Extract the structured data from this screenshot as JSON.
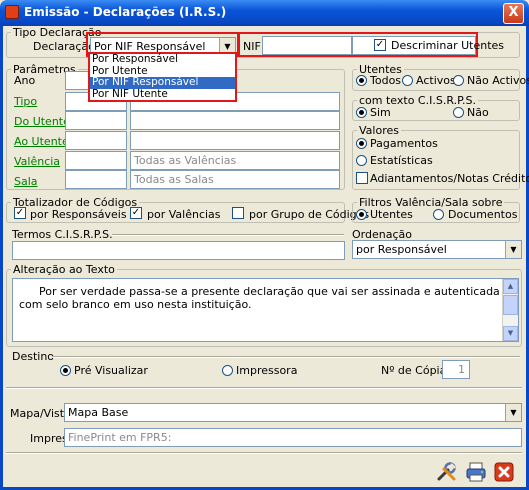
{
  "window": {
    "title": "Emissão - Declarações (I.R.S.)",
    "close": "X"
  },
  "tipo": {
    "legend": "Tipo Declaração",
    "declaracao_label": "Declaração",
    "declaracao_value": "Por NIF Responsável",
    "options": [
      "Por Responsável",
      "Por Utente",
      "Por NIF Responsável",
      "Por NIF Utente"
    ],
    "selected_index": 2,
    "nif_label": "NIF",
    "nif_value": "",
    "discriminar_label": "Descriminar Utentes",
    "discriminar_checked": true
  },
  "parametros": {
    "legend": "Parâmetros",
    "ano_label": "Ano",
    "tipo_label": "Tipo",
    "do_utente_label": "Do Utente",
    "ao_utente_label": "Ao Utente",
    "valencia_label": "Valência",
    "valencia_placeholder": "Todas as Valências",
    "sala_label": "Sala",
    "sala_placeholder": "Todas as Salas"
  },
  "utentes": {
    "legend": "Utentes",
    "options": [
      "Todos",
      "Activos",
      "Não Activos"
    ],
    "selected": 0
  },
  "texto": {
    "legend": "com texto C.I.S.R.P.S.",
    "options": [
      "Sim",
      "Não"
    ],
    "selected": 0
  },
  "valores": {
    "legend": "Valores",
    "options": [
      "Pagamentos",
      "Estatísticas"
    ],
    "selected": 0,
    "adiantamentos_label": "Adiantamentos/Notas Crédito",
    "adiantamentos_checked": false
  },
  "totalizador": {
    "legend": "Totalizador de Códigos",
    "items": [
      {
        "label": "por Responsáveis",
        "checked": true
      },
      {
        "label": "por Valências",
        "checked": true
      },
      {
        "label": "por Grupo de Códigos",
        "checked": false
      }
    ]
  },
  "filtros": {
    "legend": "Filtros Valência/Sala sobre",
    "options": [
      "Utentes",
      "Documentos"
    ],
    "selected": 0
  },
  "termos": {
    "legend": "Termos C.I.S.R.P.S.",
    "value": ""
  },
  "ordenacao": {
    "legend": "Ordenação",
    "value": "por Responsável"
  },
  "alteracao": {
    "legend": "Alteração ao Texto",
    "text": "Por ser verdade passa-se a presente declaração que vai ser assinada e autenticada com selo branco em uso nesta instituição."
  },
  "destino": {
    "legend": "Destino",
    "options": [
      "Pré Visualizar",
      "Impressora"
    ],
    "selected": 0,
    "copias_label": "Nº de Cópias",
    "copias_value": "1"
  },
  "mapa": {
    "label": "Mapa/Vista",
    "value": "Mapa Base"
  },
  "impressora": {
    "label": "Impressora",
    "placeholder": "FinePrint em FPR5:"
  },
  "colors": {
    "title_bar": "#0a54d8",
    "highlight": "#e01818",
    "selection": "#316ac5",
    "link": "#008000"
  },
  "icons": [
    "tools-icon",
    "printer-icon",
    "exit-icon"
  ]
}
